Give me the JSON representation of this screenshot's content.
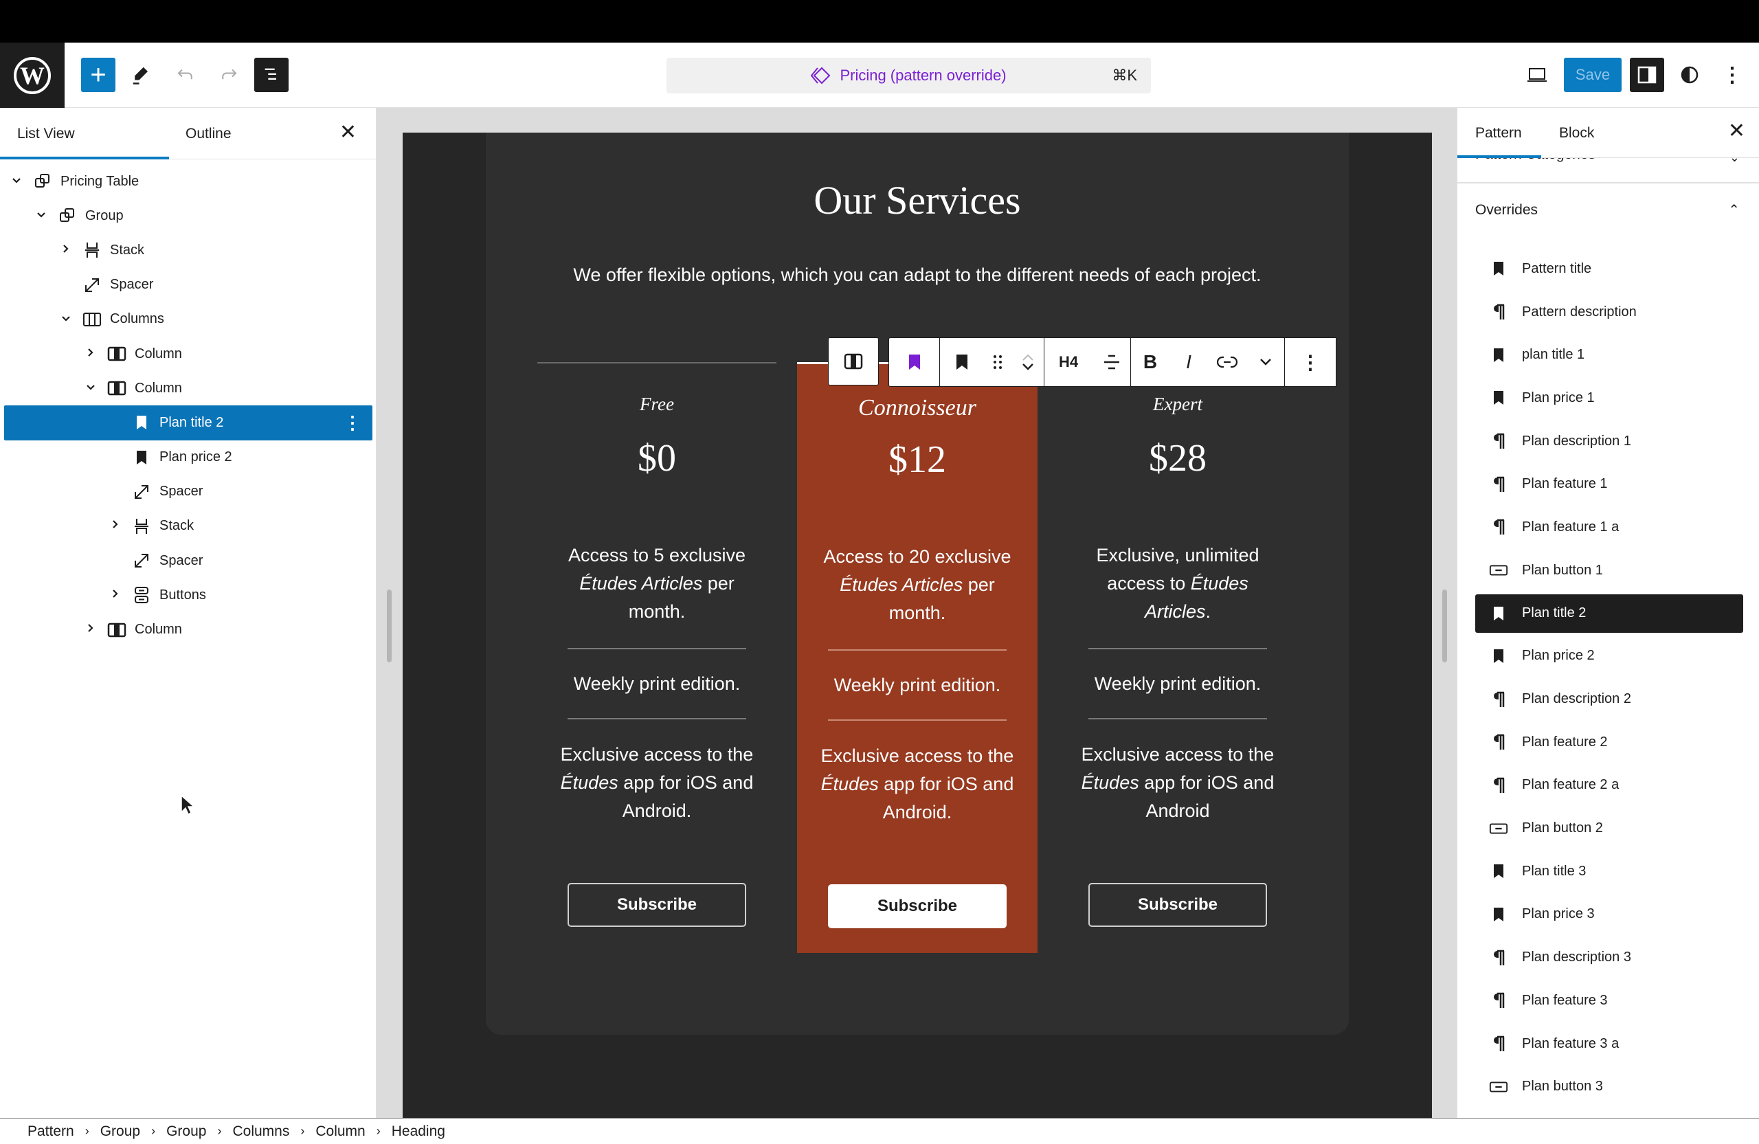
{
  "header": {
    "command_bar": {
      "label": "Pricing (pattern override)",
      "shortcut": "⌘K"
    },
    "save_label": "Save"
  },
  "left_panel": {
    "tabs": [
      {
        "label": "List View",
        "active": true
      },
      {
        "label": "Outline",
        "active": false
      }
    ],
    "tree": [
      {
        "label": "Pricing Table",
        "level": 0,
        "icon": "group-icon",
        "chevron": "down"
      },
      {
        "label": "Group",
        "level": 1,
        "icon": "group-icon",
        "chevron": "down"
      },
      {
        "label": "Stack",
        "level": 2,
        "icon": "stack-icon",
        "chevron": "right"
      },
      {
        "label": "Spacer",
        "level": 2,
        "icon": "spacer-icon",
        "chevron": ""
      },
      {
        "label": "Columns",
        "level": 2,
        "icon": "columns-icon",
        "chevron": "down"
      },
      {
        "label": "Column",
        "level": 3,
        "icon": "column-icon",
        "chevron": "right"
      },
      {
        "label": "Column",
        "level": 3,
        "icon": "column-icon",
        "chevron": "down"
      },
      {
        "label": "Plan title 2",
        "level": 4,
        "icon": "bookmark-icon",
        "chevron": "",
        "selected": true
      },
      {
        "label": "Plan price 2",
        "level": 4,
        "icon": "bookmark-icon",
        "chevron": ""
      },
      {
        "label": "Spacer",
        "level": 4,
        "icon": "spacer-icon",
        "chevron": ""
      },
      {
        "label": "Stack",
        "level": 4,
        "icon": "stack-icon",
        "chevron": "right"
      },
      {
        "label": "Spacer",
        "level": 4,
        "icon": "spacer-icon",
        "chevron": ""
      },
      {
        "label": "Buttons",
        "level": 4,
        "icon": "buttons-icon",
        "chevron": "right"
      },
      {
        "label": "Column",
        "level": 3,
        "icon": "column-icon",
        "chevron": "right"
      }
    ]
  },
  "canvas": {
    "title": "Our Services",
    "description": "We offer flexible options, which you can adapt to the different needs of each project.",
    "plans": [
      {
        "title": "Free",
        "price": "$0",
        "description_pre": "Access to 5 exclusive ",
        "description_em1": "Études Articles",
        "description_post": " per month.",
        "feature1": "Weekly print edition.",
        "feature2_pre": "Exclusive access to the ",
        "feature2_em": "Études",
        "feature2_post": " app for iOS and Android.",
        "button": "Subscribe",
        "featured": false
      },
      {
        "title": "Connoisseur",
        "price": "$12",
        "description_pre": "Access to 20 exclusive ",
        "description_em1": "Études Articles",
        "description_post": " per month.",
        "feature1": "Weekly print edition.",
        "feature2_pre": "Exclusive access to the ",
        "feature2_em": "Études",
        "feature2_post": " app for iOS and Android.",
        "button": "Subscribe",
        "featured": true
      },
      {
        "title": "Expert",
        "price": "$28",
        "description_pre": "Exclusive, unlimited access to ",
        "description_em1": "Études Articles",
        "description_post": ".",
        "feature1": "Weekly print edition.",
        "feature2_pre": "Exclusive access to the ",
        "feature2_em": "Études",
        "feature2_post": " app for iOS and Android",
        "button": "Subscribe",
        "featured": false
      }
    ],
    "block_toolbar": {
      "heading_level": "H4"
    }
  },
  "right_panel": {
    "tabs": [
      {
        "label": "Pattern",
        "active": true
      },
      {
        "label": "Block",
        "active": false
      }
    ],
    "categories_label": "Pattern Categories",
    "overrides_label": "Overrides",
    "overrides": [
      {
        "label": "Pattern title",
        "icon": "bookmark-icon"
      },
      {
        "label": "Pattern description",
        "icon": "paragraph-icon"
      },
      {
        "label": "plan title 1",
        "icon": "bookmark-icon"
      },
      {
        "label": "Plan price 1",
        "icon": "bookmark-icon"
      },
      {
        "label": "Plan description 1",
        "icon": "paragraph-icon"
      },
      {
        "label": "Plan feature 1",
        "icon": "paragraph-icon"
      },
      {
        "label": "Plan feature 1 a",
        "icon": "paragraph-icon"
      },
      {
        "label": "Plan button 1",
        "icon": "button-icon"
      },
      {
        "label": "Plan title 2",
        "icon": "bookmark-icon",
        "selected": true
      },
      {
        "label": "Plan price 2",
        "icon": "bookmark-icon"
      },
      {
        "label": "Plan description 2",
        "icon": "paragraph-icon"
      },
      {
        "label": "Plan feature 2",
        "icon": "paragraph-icon"
      },
      {
        "label": "Plan feature 2 a",
        "icon": "paragraph-icon"
      },
      {
        "label": "Plan button 2",
        "icon": "button-icon"
      },
      {
        "label": "Plan title 3",
        "icon": "bookmark-icon"
      },
      {
        "label": "Plan price 3",
        "icon": "bookmark-icon"
      },
      {
        "label": "Plan description 3",
        "icon": "paragraph-icon"
      },
      {
        "label": "Plan feature 3",
        "icon": "paragraph-icon"
      },
      {
        "label": "Plan feature 3 a",
        "icon": "paragraph-icon"
      },
      {
        "label": "Plan button 3",
        "icon": "button-icon"
      }
    ]
  },
  "breadcrumb": [
    "Pattern",
    "Group",
    "Group",
    "Columns",
    "Column",
    "Heading"
  ],
  "colors": {
    "accent": "#0a7cc1",
    "pattern_purple": "#7a1fd3",
    "featured_plan": "#973a20",
    "canvas_dark": "#262626",
    "card": "#2f2f2f"
  }
}
